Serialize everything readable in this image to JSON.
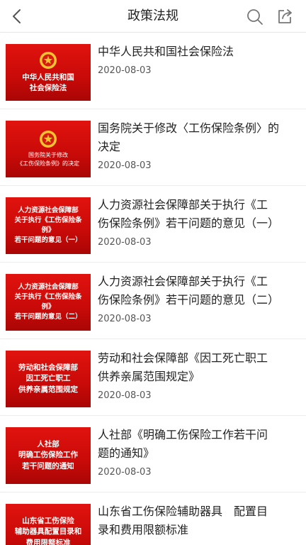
{
  "header": {
    "title": "政策法规"
  },
  "items": [
    {
      "thumb_text": "中华人民共和国\n社会保险法",
      "title": "中华人民共和国社会保险法",
      "date": "2020-08-03"
    },
    {
      "thumb_text": "国务院关于修改\n《工伤保险条例》的决定",
      "title": "国务院关于修改〈工伤保险条例〉的\n决定",
      "date": "2020-08-03"
    },
    {
      "thumb_text": "人力资源社会保障部\n关于执行《工伤保险条例》\n若干问题的意见（一）",
      "title": "人力资源社会保障部关于执行《工\n伤保险条例》若干问题的意见（一）",
      "date": "2020-08-03"
    },
    {
      "thumb_text": "人力资源社会保障部\n关于执行《工伤保险条例》\n若干问题的意见（二）",
      "title": "人力资源社会保障部关于执行《工\n伤保险条例》若干问题的意见（二）",
      "date": "2020-08-03"
    },
    {
      "thumb_text": "劳动和社会保障部\n因工死亡职工\n供养亲属范围规定",
      "title": "劳动和社会保障部《因工死亡职工\n供养亲属范围规定》",
      "date": "2020-08-03"
    },
    {
      "thumb_text": "人社部\n明确工伤保险工作\n若干问题的通知",
      "title": "人社部《明确工伤保险工作若干问\n题的通知》",
      "date": "2020-08-03"
    },
    {
      "thumb_text": "山东省工伤保险\n辅助器具配置目录和\n费用限额标准",
      "title": "山东省工伤保险辅助器具　配置目\n录和费用限额标准",
      "date": ""
    }
  ]
}
